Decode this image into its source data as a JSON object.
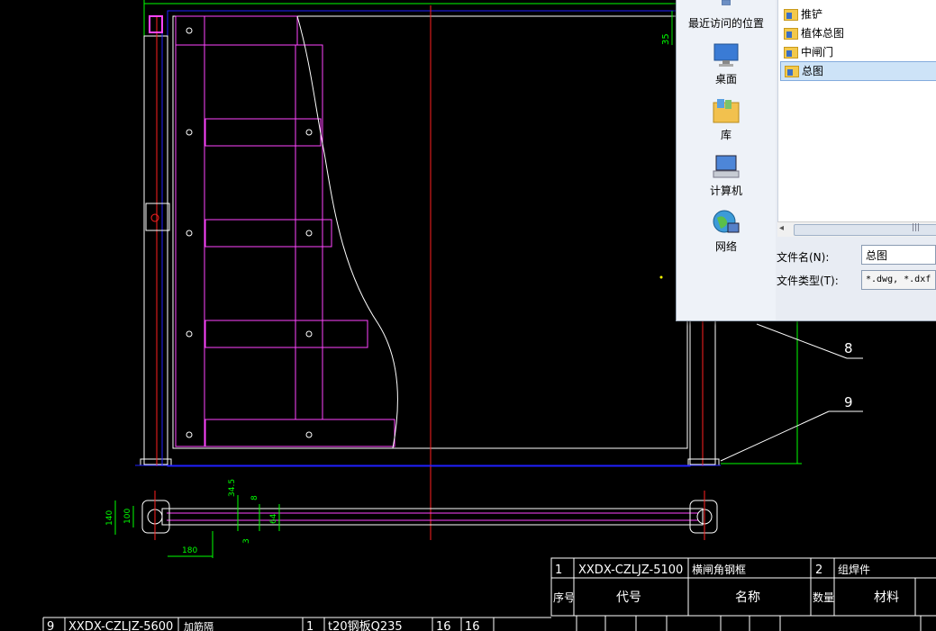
{
  "window": {
    "title": ""
  },
  "drawing": {
    "dims": {
      "d35_top": "35",
      "d345": "34.5",
      "d8": "8",
      "d64": "64",
      "d3": "3",
      "d140": "140",
      "d100": "100",
      "d180": "180"
    },
    "balloons": {
      "b8": "8",
      "b9": "9"
    }
  },
  "title_block": {
    "row1": {
      "seq": "1",
      "code": "XXDX-CZLJZ-5100",
      "name": "横闸角钢框",
      "qty": "2",
      "mat": "组焊件"
    },
    "header": {
      "seq": "序号",
      "code": "代号",
      "name": "名称",
      "qty": "数量",
      "mat": "材料"
    },
    "row_bottom": {
      "seq": "9",
      "code": "XXDX-CZLJZ-5600",
      "name": "加筋隔",
      "qty": "1",
      "mat": "t20钢板Q235",
      "w1": "16",
      "w2": "16"
    }
  },
  "dialog": {
    "places": [
      "最近访问的位置",
      "桌面",
      "库",
      "计算机",
      "网络"
    ],
    "folders": [
      "推铲",
      "植体总图",
      "中闸门",
      "总图"
    ],
    "selected_folder": "总图",
    "filename_label": "文件名(N):",
    "filename_value": "总图",
    "filetype_label": "文件类型(T):",
    "filetype_value": "*.dwg, *.dxf"
  },
  "colors": {
    "wire_white": "#ffffff",
    "magenta": "#ff44ff",
    "red": "#ff2020",
    "green": "#00ff00",
    "blue": "#2020ff",
    "dialog_bg": "#e8ecf3"
  }
}
